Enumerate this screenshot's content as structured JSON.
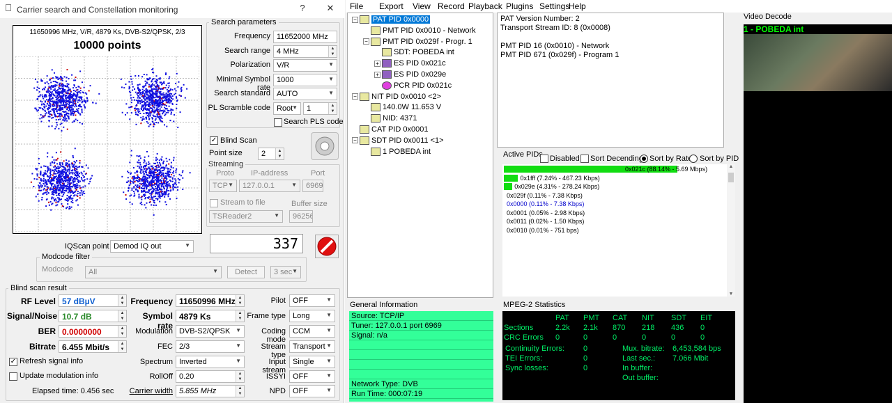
{
  "dialog": {
    "title": "Carrier search and Constellation monitoring",
    "help": "?",
    "close": "✕"
  },
  "constellation": {
    "info": "11650996 MHz, V/R, 4879 Ks, DVB-S2/QPSK, 2/3",
    "points_label": "10000 points"
  },
  "search": {
    "group_label": "Search parameters",
    "frequency_label": "Frequency",
    "frequency": "11652000 MHz",
    "range_label": "Search range",
    "range": "4 MHz",
    "polarization_label": "Polarization",
    "polarization": "V/R",
    "msr_label": "Minimal Symbol rate",
    "msr": "1000",
    "standard_label": "Search standard",
    "standard": "AUTO",
    "pl_label": "PL Scramble code",
    "pl_mode": "Root",
    "pl_value": "1",
    "search_pls": "Search PLS code"
  },
  "blind": {
    "label": "Blind Scan",
    "checked": true,
    "point_size_label": "Point size",
    "point_size": "2"
  },
  "streaming": {
    "group_label": "Streaming",
    "proto_hdr": "Proto",
    "ip_hdr": "IP-address",
    "port_hdr": "Port",
    "proto": "TCP",
    "ip": "127.0.0.1",
    "port": "6969",
    "stream_file": "Stream to file",
    "buffer_label": "Buffer size",
    "reader": "TSReader2",
    "buffer": "96256"
  },
  "counter": "337",
  "iqscan": {
    "label": "IQScan point",
    "value": "Demod IQ out"
  },
  "modcode": {
    "group_label": "Modcode filter",
    "label": "Modcode",
    "value": "All",
    "detect": "Detect",
    "delay": "3 sec"
  },
  "result": {
    "group_label": "Blind scan result",
    "rf_label": "RF Level",
    "rf": "57 dBµV",
    "snr_label": "Signal/Noise",
    "snr": "10.7 dB",
    "ber_label": "BER",
    "ber": "0.0000000",
    "bitrate_label": "Bitrate",
    "bitrate": "6.455 Mbit/s",
    "refresh": "Refresh signal info",
    "update_mod": "Update modulation info",
    "elapsed": "Elapsed time: 0.456 sec",
    "freq_label": "Frequency",
    "freq": "11650996 MHz",
    "sr_label": "Symbol rate",
    "sr": "4879 Ks",
    "mod_label": "Modulation",
    "mod": "DVB-S2/QPSK",
    "fec_label": "FEC",
    "fec": "2/3",
    "spec_label": "Spectrum",
    "spec": "Inverted",
    "roll_label": "RollOff",
    "roll": "0.20",
    "cw_label": "Carrier width",
    "cw": "5.855 MHz",
    "pilot_label": "Pilot",
    "pilot": "OFF",
    "frame_label": "Frame type",
    "frame": "Long",
    "coding_label": "Coding mode",
    "coding": "CCM",
    "stype_label": "Stream type",
    "stype": "Transport",
    "istream_label": "Input stream",
    "istream": "Single",
    "issyi_label": "ISSYI",
    "issyi": "OFF",
    "npd_label": "NPD",
    "npd": "OFF"
  },
  "menu": [
    "File",
    "Export",
    "View",
    "Record",
    "Playback",
    "Plugins",
    "Settings",
    "Help"
  ],
  "tree": [
    {
      "t": "PAT PID 0x0000",
      "lv": 0,
      "exp": "−",
      "sel": true,
      "ic": "PAT"
    },
    {
      "t": "PMT PID 0x0010 - Network",
      "lv": 1,
      "exp": "",
      "ic": "PMT"
    },
    {
      "t": "PMT PID 0x029f - Progr. 1",
      "lv": 1,
      "exp": "−",
      "ic": "PMT"
    },
    {
      "t": "SDT: POBEDA int",
      "lv": 2,
      "exp": "",
      "ic": "SDT"
    },
    {
      "t": "ES PID 0x021c",
      "lv": 2,
      "exp": "+",
      "ic": "ES"
    },
    {
      "t": "ES PID 0x029e",
      "lv": 2,
      "exp": "+",
      "ic": "ES"
    },
    {
      "t": "PCR PID 0x021c",
      "lv": 2,
      "exp": "",
      "ic": "PCR"
    },
    {
      "t": "NIT PID 0x0010 <2>",
      "lv": 0,
      "exp": "−",
      "ic": "NIT"
    },
    {
      "t": "140.0W 11.653 V",
      "lv": 1,
      "exp": "",
      "ic": "NIT"
    },
    {
      "t": "NID: 4371",
      "lv": 1,
      "exp": "",
      "ic": "NIT"
    },
    {
      "t": "CAT PID 0x0001",
      "lv": 0,
      "exp": "",
      "ic": "CAT"
    },
    {
      "t": "SDT PID 0x0011 <1>",
      "lv": 0,
      "exp": "−",
      "ic": "SDT"
    },
    {
      "t": "1 POBEDA int",
      "lv": 1,
      "exp": "",
      "ic": "SDT"
    }
  ],
  "info": "PAT Version Number: 2\nTransport Stream ID: 8 (0x0008)\n\nPMT PID 16 (0x0010) - Network\nPMT PID 671 (0x029f) - Program 1",
  "active_pids": {
    "label": "Active PIDs",
    "disabled": "Disabled",
    "sortdec": "Sort Decending",
    "byrate": "Sort by Rate",
    "bypid": "Sort by PID",
    "rows": [
      {
        "t": "0x021c (88.14% - 5.69 Mbps)",
        "pct": 88.14,
        "c": "#000"
      },
      {
        "t": "0x1fff (7.24% - 467.23 Kbps)",
        "pct": 7.24,
        "c": "#000"
      },
      {
        "t": "0x029e (4.31% - 278.24 Kbps)",
        "pct": 4.31,
        "c": "#000"
      },
      {
        "t": "0x029f (0.11% - 7.38 Kbps)",
        "pct": 0.11,
        "c": "#000"
      },
      {
        "t": "0x0000 (0.11% - 7.38 Kbps)",
        "pct": 0.11,
        "c": "#0000cc"
      },
      {
        "t": "0x0001 (0.05% - 2.98 Kbps)",
        "pct": 0.05,
        "c": "#000"
      },
      {
        "t": "0x0011 (0.02% - 1.50 Kbps)",
        "pct": 0.02,
        "c": "#000"
      },
      {
        "t": "0x0010 (0.01% - 751 bps)",
        "pct": 0.01,
        "c": "#000"
      }
    ]
  },
  "general": {
    "label": "General Information",
    "lines": [
      "Source: TCP/IP",
      "Tuner: 127.0.0.1 port 6969",
      "Signal: n/a",
      "",
      "",
      "",
      "",
      "Network Type: DVB",
      "Run Time: 000:07:19"
    ]
  },
  "mpeg": {
    "label": "MPEG-2 Statistics",
    "headers": [
      "PAT",
      "PMT",
      "CAT",
      "NIT",
      "SDT",
      "EIT"
    ],
    "sections_label": "Sections",
    "sections": [
      "2.2k",
      "2.1k",
      "870",
      "218",
      "436",
      "0"
    ],
    "crc_label": "CRC Errors",
    "crc": [
      "0",
      "0",
      "0",
      "0",
      "0",
      "0"
    ],
    "cont_label": "Continuity Errors:",
    "cont": "0",
    "tei_label": "TEI Errors:",
    "tei": "0",
    "sync_label": "Sync losses:",
    "sync": "0",
    "mux_label": "Mux. bitrate:",
    "mux": "6,453,584 bps",
    "last_label": "Last sec.:",
    "last": "7.066 Mbit",
    "inbuf_label": "In buffer:",
    "outbuf_label": "Out buffer:"
  },
  "video": {
    "label": "Video Decode",
    "channel": "1 - POBEDA int"
  }
}
